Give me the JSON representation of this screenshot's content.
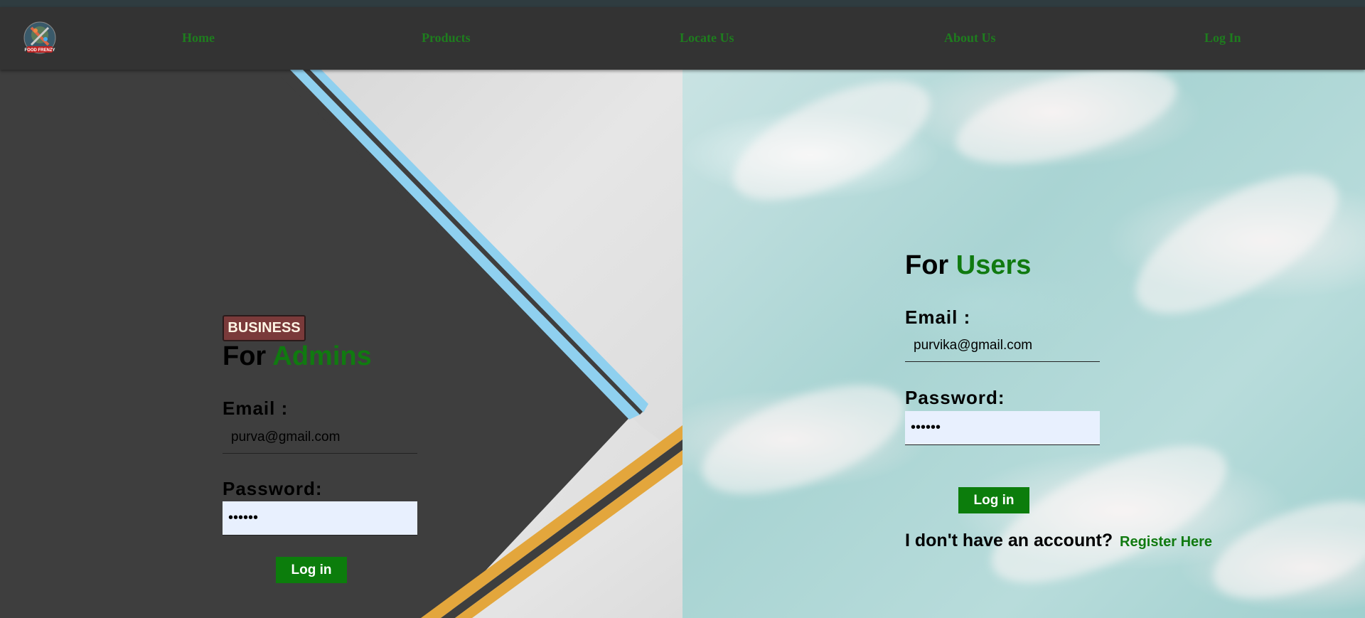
{
  "nav": {
    "logo_icon": "food-frenzy-logo",
    "logo_text": "FOOD FRENZY",
    "items": [
      {
        "label": "Home"
      },
      {
        "label": "Products"
      },
      {
        "label": "Locate Us"
      },
      {
        "label": "About Us"
      },
      {
        "label": "Log In"
      }
    ],
    "link_color": "#1e7d1e"
  },
  "admin": {
    "badge": "BUSINESS",
    "heading_prefix": "For",
    "heading_accent": "Admins",
    "email_label": "Email :",
    "email_value": "purva@gmail.com",
    "password_label": "Password:",
    "password_value": "••••••",
    "login_button": "Log in"
  },
  "user": {
    "heading_prefix": "For",
    "heading_accent": "Users",
    "email_label": "Email :",
    "email_value": "purvika@gmail.com",
    "password_label": "Password:",
    "password_value": "••••••",
    "login_button": "Log in",
    "register_prompt": "I don't have an account?",
    "register_link": "Register Here"
  },
  "colors": {
    "accent_green": "#107a10",
    "button_green": "#0c7d0c",
    "navbar_bg": "#333333",
    "badge_bg": "#7a3a3a"
  }
}
